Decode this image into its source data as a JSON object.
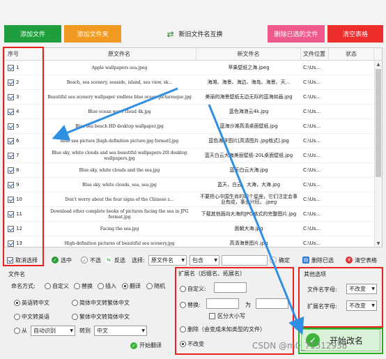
{
  "toolbar": {
    "add_file": "添加文件",
    "add_folder": "添加文件夹",
    "swap": "新旧文件名互换",
    "delete_selected": "删除已选的文件",
    "clear_table": "清空表格"
  },
  "table": {
    "headers": {
      "index": "序号",
      "original": "原文件名",
      "new": "新文件名",
      "location": "文件位置",
      "status": "状态"
    },
    "rows": [
      {
        "index": "1",
        "original": "Apple wallpapers sea.jpeg",
        "new": "苹果壁纸之海.jpeg",
        "location": "C:\\Us..."
      },
      {
        "index": "2",
        "original": "Beach, sea scenery, seaside, island, sea view, sk...",
        "new": "海滩、海景、海边、海岛、海景、天...",
        "location": "C:\\Us..."
      },
      {
        "index": "3",
        "original": "Beautiful sea scenery wallpaper endless blue ocean picturesque.jpg",
        "new": "美丽的海景壁纸无边无际的蓝海如画.jpg",
        "location": "C:\\Us..."
      },
      {
        "index": "4",
        "original": "Blue ocean wave cloud 4k.jpg",
        "new": "蓝色海浪云4k.jpg",
        "location": "C:\\Us..."
      },
      {
        "index": "5",
        "original": "Blue sea beach HD desktop wallpaper.jpg",
        "new": "蓝海沙滩高清桌面壁纸.jpg",
        "location": "C:\\Us..."
      },
      {
        "index": "6",
        "original": "Blue sea picture [high definition picture.jpg format].jpg",
        "new": "蓝色海洋图片[高清图片.jpg格式].jpg",
        "location": "C:\\Us..."
      },
      {
        "index": "7",
        "original": "Blue sky, white clouds and sea beautiful wallpapers-20l desktop wallpapers.jpg",
        "new": "蓝天白云大海美丽壁纸-20L桌面壁纸.jpg",
        "location": "C:\\Us..."
      },
      {
        "index": "8",
        "original": "Blue sky, white clouds and the sea.jpg",
        "new": "蓝天白云大海.jpg",
        "location": "C:\\Us..."
      },
      {
        "index": "9",
        "original": "Blue sky, white clouds, sea, sea.jpg",
        "new": "蓝天，白云，大海，大海.jpg",
        "location": "C:\\Us..."
      },
      {
        "index": "10",
        "original": "Don't worry about the four signs of the Chinese z...",
        "new": "不要担心中国生肖的四个星座，它们注定会事业有成，事业兴旺。.jpeg",
        "location": "C:\\Us..."
      },
      {
        "index": "11",
        "original": "Download other complete books of pictures facing the sea in JPG format.jpg",
        "new": "下载其他面向大海的JPG格式的完整图片.jpg",
        "location": "C:\\Us..."
      },
      {
        "index": "12",
        "original": "Facing the sea.jpg",
        "new": "面朝大海.jpg",
        "location": "C:\\Us..."
      },
      {
        "index": "13",
        "original": "High-definition pictures of beautiful sea scenery.jpg",
        "new": "高清海景图片.jpg",
        "location": "C:\\Us..."
      }
    ]
  },
  "selection_bar": {
    "invert": "取消选择",
    "select": "选中",
    "unselect": "不选",
    "reverse": "反选",
    "condition_label": "选择:",
    "field_value": "原文件名",
    "op_value": "包含",
    "confirm": "确定",
    "delete_selected": "删除已选",
    "clear_table": "清空表格"
  },
  "filename_panel": {
    "title": "文件名",
    "naming_label": "命名方式:",
    "naming_options": [
      "自定义",
      "替换",
      "插入",
      "翻译",
      "随机"
    ],
    "naming_selected": "翻译",
    "translate_options": [
      "英语转中文",
      "简体中文转繁体中文",
      "中文转英语",
      "繁体中文转简体中文"
    ],
    "translate_selected": "英语转中文",
    "from_label": "从",
    "from_value": "自动识别",
    "to_label": "转到",
    "to_value": "中文",
    "start_translate": "开始翻译"
  },
  "extension_panel": {
    "title": "扩展名（后缀名、拓展名）",
    "custom": "自定义:",
    "replace": "替换:",
    "as_label": "为",
    "case_sensitive": "区分大小写",
    "delete": "删除（会变成未知类型的文件）",
    "unchanged": "不改变",
    "selected": "不改变"
  },
  "other_panel": {
    "title": "其他选项",
    "filename_case_label": "文件名字母:",
    "filename_case_value": "不改变",
    "ext_case_label": "扩展名字母:",
    "ext_case_value": "不改变"
  },
  "start_button": "开始改名",
  "watermark": "CSDN @m0_71312938",
  "colors": {
    "add_file": "#1e9e3c",
    "add_folder": "#f19a22",
    "delete_selected": "#f05a8a",
    "clear_table": "#ee2d2d",
    "annotation_red": "#e8201e",
    "annotation_green": "#26b020",
    "arrow_blue": "#2f8fe3"
  }
}
